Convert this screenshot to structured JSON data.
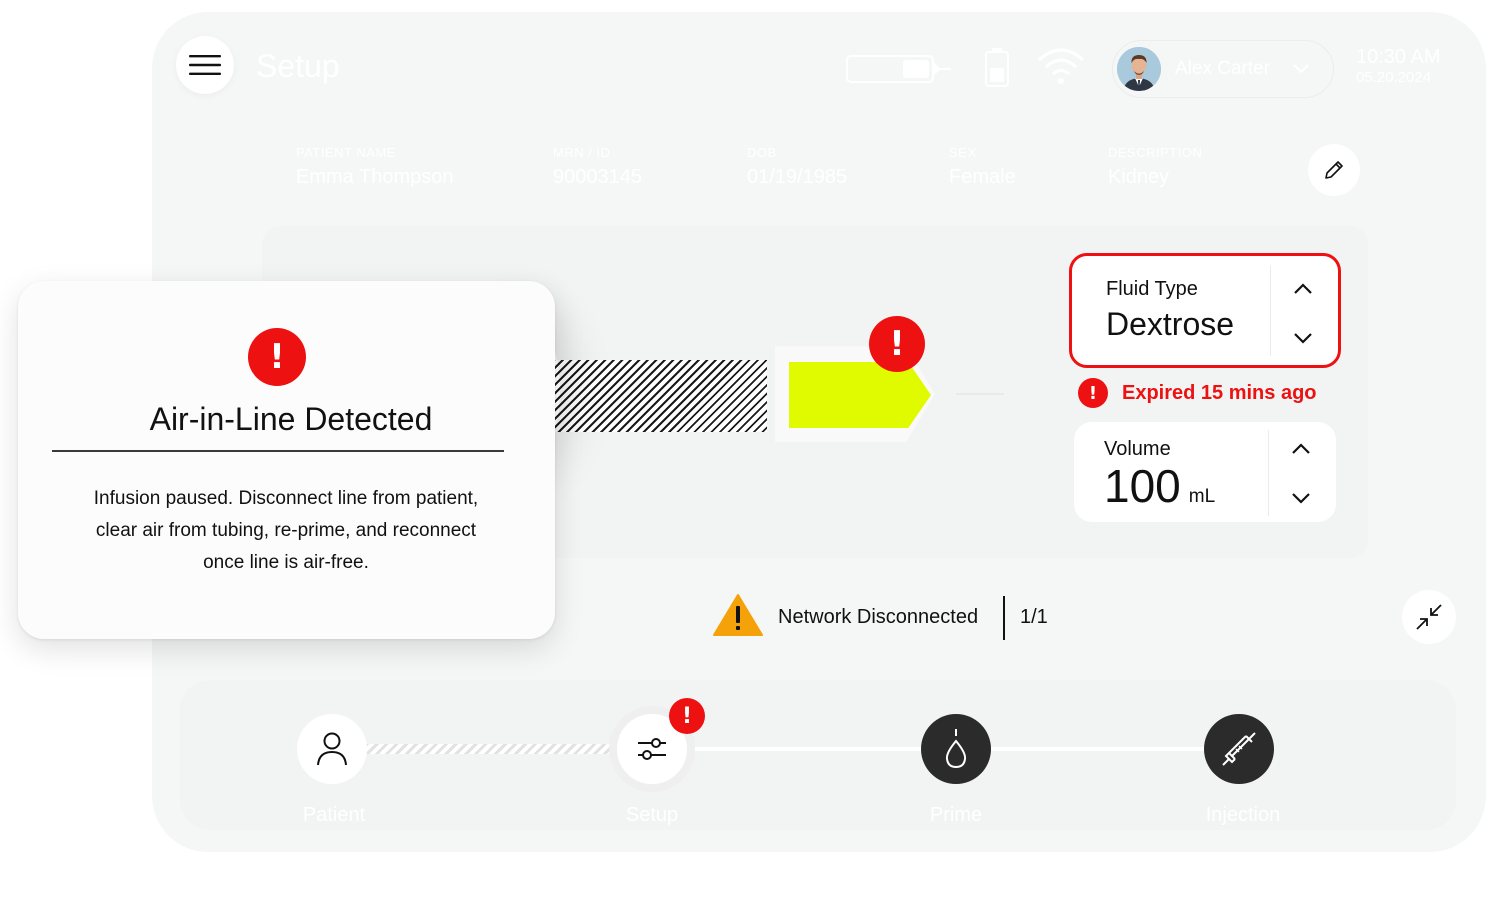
{
  "header": {
    "title": "Setup",
    "user_name": "Alex Carter",
    "time": "10:30 AM",
    "date": "05.20.2024"
  },
  "patient": [
    {
      "label": "PATIENT NAME",
      "value": "Emma Thompson"
    },
    {
      "label": "MRN / ID",
      "value": "90003145"
    },
    {
      "label": "DOB",
      "value": "01/19/1985"
    },
    {
      "label": "SEX",
      "value": "Female"
    },
    {
      "label": "DESCRIPTION",
      "value": "Kidney"
    }
  ],
  "fluid": {
    "label": "Fluid Type",
    "value": "Dextrose",
    "expired_text": "Expired 15 mins ago"
  },
  "volume": {
    "label": "Volume",
    "value": "100",
    "unit": "mL"
  },
  "network": {
    "message": "Network Disconnected",
    "count": "1/1"
  },
  "steps": [
    {
      "label": "Patient",
      "icon": "person-icon"
    },
    {
      "label": "Setup",
      "icon": "sliders-icon"
    },
    {
      "label": "Prime",
      "icon": "drop-icon"
    },
    {
      "label": "Injection",
      "icon": "syringe-icon"
    }
  ],
  "alert": {
    "badge": "!",
    "title": "Air-in-Line Detected",
    "body": "Infusion paused. Disconnect line from patient, clear air from tubing, re-prime, and reconnect once line is air-free."
  },
  "colors": {
    "accent_error": "#ee1111",
    "flow_arrow": "#e0fb00",
    "warning": "#f5a10a",
    "dark_step": "#2b2b2b"
  }
}
